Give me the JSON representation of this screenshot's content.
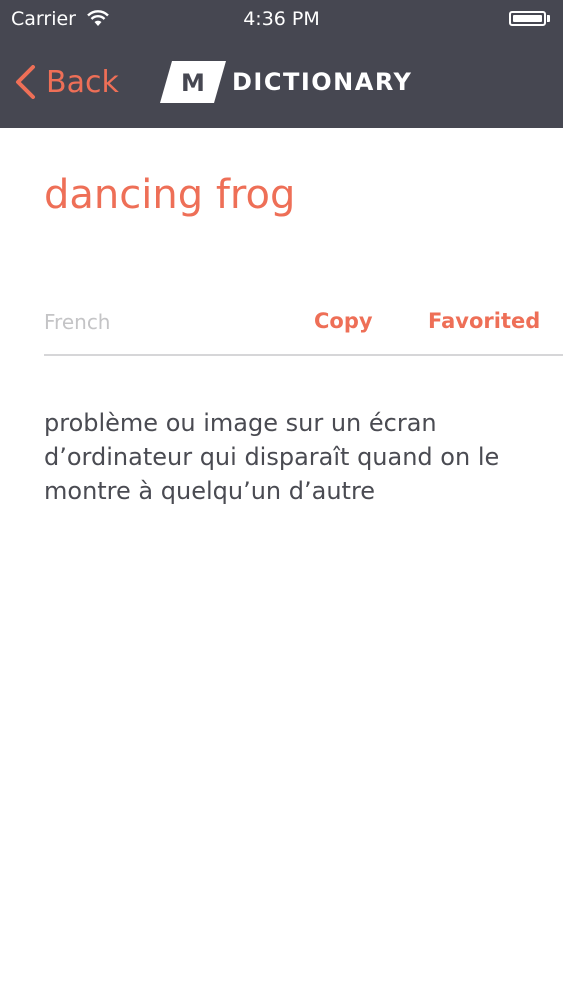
{
  "status_bar": {
    "carrier": "Carrier",
    "time": "4:36 PM"
  },
  "nav": {
    "back_label": "Back",
    "logo_letter": "M",
    "logo_text": "DICTIONARY"
  },
  "entry": {
    "term": "dancing frog",
    "language": "French",
    "copy_label": "Copy",
    "favorite_label": "Favorited",
    "definition": "problème ou image sur un écran d’ordinateur qui disparaît quand on le montre à quelqu’un d’autre"
  },
  "colors": {
    "accent": "#ee6f57",
    "nav_bg": "#464751",
    "text": "#4a4b52",
    "muted": "#c4c4c6"
  },
  "icons": [
    "wifi-icon",
    "battery-icon",
    "back-chevron-icon"
  ]
}
